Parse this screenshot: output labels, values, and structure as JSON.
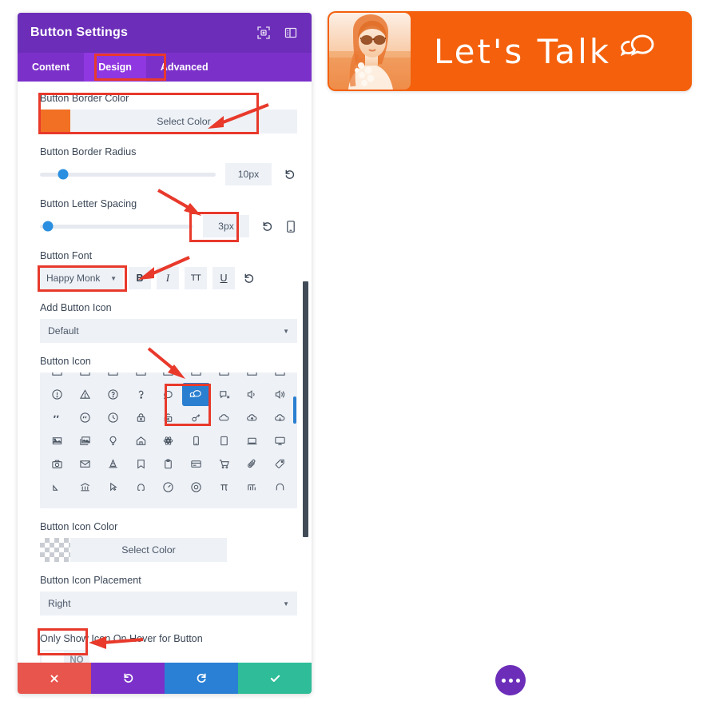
{
  "panel": {
    "title": "Button Settings",
    "header_icons": [
      {
        "name": "focus-icon"
      },
      {
        "name": "layout-panel-icon"
      }
    ],
    "tabs": [
      {
        "label": "Content",
        "active": false
      },
      {
        "label": "Design",
        "active": true
      },
      {
        "label": "Advanced",
        "active": false
      }
    ],
    "fields": {
      "border_color": {
        "label": "Button Border Color",
        "button_label": "Select Color",
        "swatch_color": "#f27024"
      },
      "border_radius": {
        "label": "Button Border Radius",
        "value": "10px",
        "slider_percent": 13
      },
      "letter_spacing": {
        "label": "Button Letter Spacing",
        "value": "3px",
        "slider_percent": 5
      },
      "button_font": {
        "label": "Button Font",
        "value": "Happy Monk",
        "format_buttons": [
          "B",
          "I",
          "TT",
          "U"
        ]
      },
      "add_button_icon": {
        "label": "Add Button Icon",
        "value": "Default"
      },
      "button_icon": {
        "label": "Button Icon",
        "selected_icon": "chat-bubbles-icon"
      },
      "icon_color": {
        "label": "Button Icon Color",
        "button_label": "Select Color",
        "swatch_color": "transparent"
      },
      "icon_placement": {
        "label": "Button Icon Placement",
        "value": "Right"
      },
      "hover_only": {
        "label": "Only Show Icon On Hover for Button",
        "value": "NO"
      }
    },
    "footer_buttons": [
      {
        "name": "cancel-button",
        "icon": "close-icon",
        "color": "#e8554d"
      },
      {
        "name": "undo-button",
        "icon": "undo-icon",
        "color": "#7b31c9"
      },
      {
        "name": "redo-button",
        "icon": "redo-icon",
        "color": "#2a80d4"
      },
      {
        "name": "save-button",
        "icon": "check-icon",
        "color": "#2fbd99"
      }
    ]
  },
  "preview": {
    "button_text": "Let's Talk",
    "button_color": "#f4600c",
    "icon": "chat-bubbles-icon",
    "photo_alt": "woman-with-sunglasses-photo"
  },
  "fab": {
    "name": "more-options-button"
  }
}
